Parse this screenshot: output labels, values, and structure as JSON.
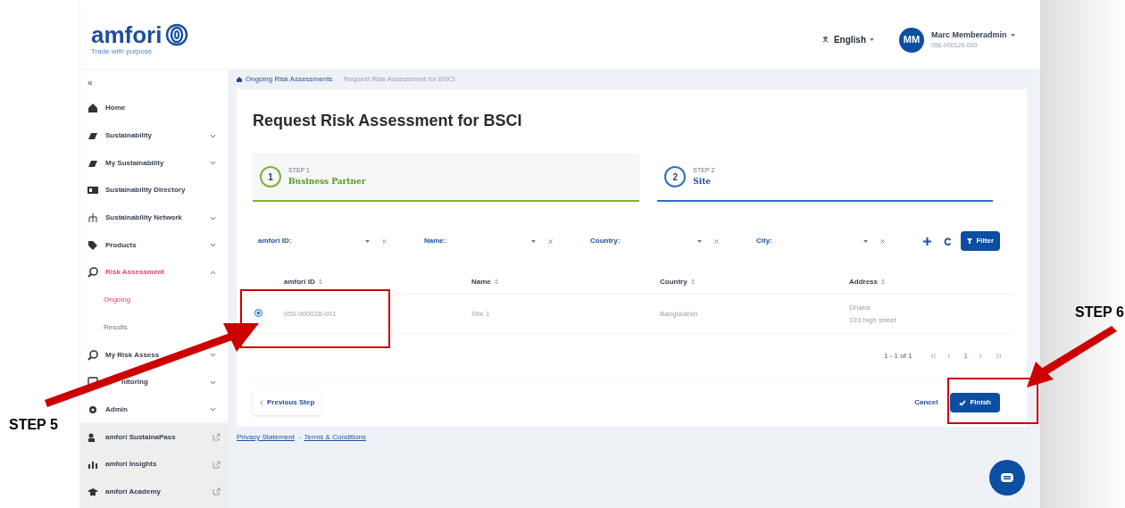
{
  "header": {
    "logo": "amfori",
    "tagline": "Trade with purpose",
    "language": "English",
    "user": {
      "initials": "MM",
      "name": "Marc Memberadmin",
      "id": "056-000126-000"
    }
  },
  "sidebar": {
    "collapse": "«",
    "items": [
      {
        "label": "Home",
        "selected": false
      },
      {
        "label": "Sustainability",
        "selected": false,
        "expanded": false
      },
      {
        "label": "My Sustainability",
        "selected": false,
        "expanded": false
      },
      {
        "label": "Sustainability Directory",
        "selected": false
      },
      {
        "label": "Sustainability Network",
        "selected": false,
        "expanded": false
      },
      {
        "label": "Products",
        "selected": false,
        "expanded": false
      },
      {
        "label": "Risk Assessment",
        "selected": true,
        "expanded": true,
        "children": [
          {
            "label": "Ongoing",
            "selected": true
          },
          {
            "label": "Results",
            "selected": false
          }
        ]
      },
      {
        "label": "My Risk Assess",
        "selected": false,
        "expanded": false
      },
      {
        "label": "nitoring",
        "selected": false,
        "expanded": false
      },
      {
        "label": "Admin",
        "selected": false,
        "expanded": false
      }
    ],
    "external_links": [
      "amfori SustainaPass",
      "amfori Insights",
      "amfori Academy"
    ]
  },
  "breadcrumb": [
    "Ongoing Risk Assessments",
    "Request Risk Assessment for BSCI"
  ],
  "title": "Request Risk Assessment for BSCI",
  "steps": [
    {
      "number": "1",
      "caption": "STEP 1",
      "label": "Business Partner",
      "selected": false
    },
    {
      "number": "2",
      "caption": "STEP 2",
      "label": "Site",
      "selected": true
    }
  ],
  "filters": [
    "amfori ID:",
    "Name:",
    "Country:",
    "City:"
  ],
  "filter_button": "Filter",
  "table": {
    "columns": [
      "amfori ID",
      "Name",
      "Country",
      "Address"
    ],
    "rows": [
      {
        "selected": true,
        "cells": [
          "050-000026-001",
          "Site 1",
          "Bangladesh",
          "Dhaka\n123 high street"
        ]
      }
    ]
  },
  "pagination": {
    "range": "1 - 1 of 1",
    "pages": [
      {
        "label": "1",
        "selected": true
      }
    ]
  },
  "buttons": {
    "previous": "Previous Step",
    "cancel": "Cancel",
    "finish": "Finish"
  },
  "footer_links": [
    "Privacy Statement",
    "Terms & Conditions"
  ],
  "footer_separator": "-",
  "annotations": [
    "STEP 5",
    "STEP 6"
  ]
}
